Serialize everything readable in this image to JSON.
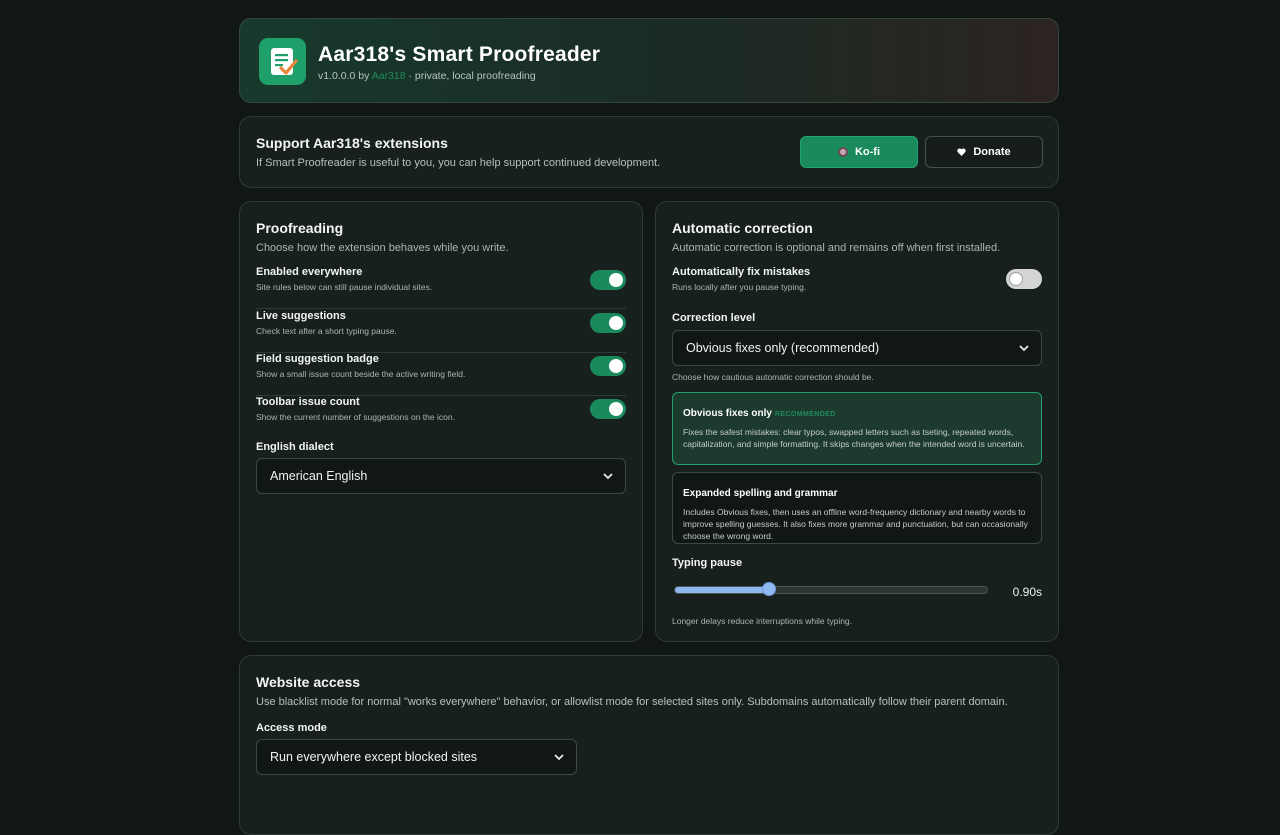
{
  "header": {
    "title": "Aar318's Smart Proofreader",
    "version": "v1.0.0.0 by",
    "author": "Aar318",
    "tagline": " · private, local proofreading",
    "logo_icon": "document-check-icon"
  },
  "support": {
    "title": "Support Aar318's extensions",
    "description": "If Smart Proofreader is useful to you, you can help support continued development.",
    "kofi_label": "Ko-fi",
    "donate_label": "Donate"
  },
  "proofreading": {
    "title": "Proofreading",
    "description": "Choose how the extension behaves while you write.",
    "toggles": [
      {
        "label": "Enabled everywhere",
        "hint": "Site rules below can still pause individual sites.",
        "on": true
      },
      {
        "label": "Live suggestions",
        "hint": "Check text after a short typing pause.",
        "on": true
      },
      {
        "label": "Field suggestion badge",
        "hint": "Show a small issue count beside the active writing field.",
        "on": true
      },
      {
        "label": "Toolbar issue count",
        "hint": "Show the current number of suggestions on the icon.",
        "on": true
      }
    ],
    "dialect_label": "English dialect",
    "dialect_value": "American English"
  },
  "auto": {
    "title": "Automatic correction",
    "description": "Automatic correction is optional and remains off when first installed.",
    "fix_label": "Automatically fix mistakes",
    "fix_hint": "Runs locally after you pause typing.",
    "fix_on": false,
    "level_label": "Correction level",
    "level_value": "Obvious fixes only (recommended)",
    "level_hint": "Choose how cautious automatic correction should be.",
    "options": [
      {
        "title": "Obvious fixes only",
        "tag": "RECOMMENDED",
        "desc": "Fixes the safest mistakes: clear typos, swapped letters such as tseting, repeated words, capitalization, and simple formatting. It skips changes when the intended word is uncertain."
      },
      {
        "title": "Expanded spelling and grammar",
        "tag": "",
        "desc": "Includes Obvious fixes, then uses an offline word-frequency dictionary and nearby words to improve spelling guesses. It also fixes more grammar and punctuation, but can occasionally choose the wrong word."
      }
    ],
    "pause_label": "Typing pause",
    "pause_value": "0.90s",
    "pause_fraction": 0.3,
    "pause_hint": "Longer delays reduce interruptions while typing."
  },
  "access": {
    "title": "Website access",
    "description": "Use blacklist mode for normal \"works everywhere\" behavior, or allowlist mode for selected sites only. Subdomains automatically follow their parent domain.",
    "mode_label": "Access mode",
    "mode_value": "Run everywhere except blocked sites"
  },
  "colors": {
    "accent": "#1a8a5c",
    "background": "#111715",
    "card": "#17201d",
    "slider": "#8fb8f0"
  }
}
